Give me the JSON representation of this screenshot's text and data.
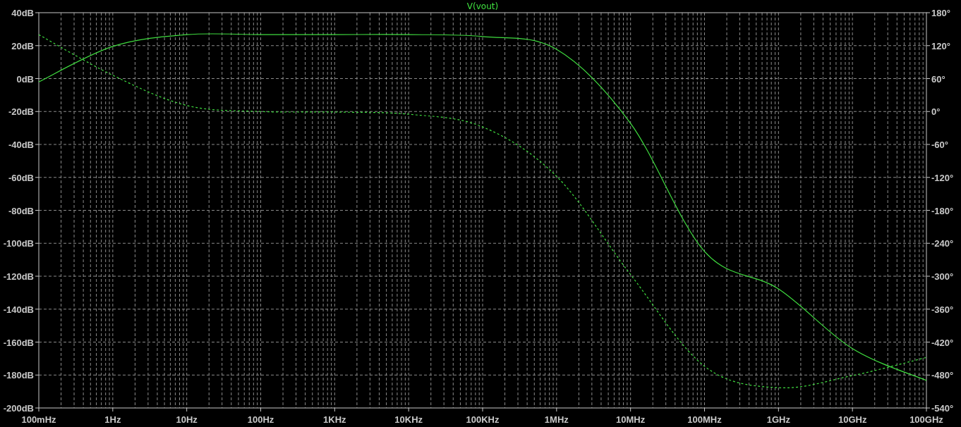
{
  "plot": {
    "chart_data": {
      "type": "line",
      "title": "V(vout)",
      "grid": true,
      "categories": [
        "100mHz",
        "1Hz",
        "10Hz",
        "100Hz",
        "1KHz",
        "10KHz",
        "100KHz",
        "1MHz",
        "10MHz",
        "100MHz",
        "1GHz",
        "10GHz",
        "100GHz"
      ],
      "ylim": [
        -200,
        40
      ],
      "yticks": [
        {
          "value": 40,
          "label": "40dB"
        },
        {
          "value": 20,
          "label": "20dB"
        },
        {
          "value": 0,
          "label": "0dB"
        },
        {
          "value": -20,
          "label": "-20dB"
        },
        {
          "value": -40,
          "label": "-40dB"
        },
        {
          "value": -60,
          "label": "-60dB"
        },
        {
          "value": -80,
          "label": "-80dB"
        },
        {
          "value": -100,
          "label": "-100dB"
        },
        {
          "value": -120,
          "label": "-120dB"
        },
        {
          "value": -140,
          "label": "-140dB"
        },
        {
          "value": -160,
          "label": "-160dB"
        },
        {
          "value": -180,
          "label": "-180dB"
        },
        {
          "value": -200,
          "label": "-200dB"
        }
      ],
      "y2lim": [
        -540,
        180
      ],
      "y2ticks": [
        {
          "value": 180,
          "label": "180°"
        },
        {
          "value": 120,
          "label": "120°"
        },
        {
          "value": 60,
          "label": "60°"
        },
        {
          "value": 0,
          "label": "0°"
        },
        {
          "value": -60,
          "label": "-60°"
        },
        {
          "value": -120,
          "label": "-120°"
        },
        {
          "value": -180,
          "label": "-180°"
        },
        {
          "value": -240,
          "label": "-240°"
        },
        {
          "value": -300,
          "label": "-300°"
        },
        {
          "value": -360,
          "label": "-360°"
        },
        {
          "value": -420,
          "label": "-420°"
        },
        {
          "value": -480,
          "label": "-480°"
        },
        {
          "value": -540,
          "label": "-540°"
        }
      ],
      "series": [
        {
          "axis": "y",
          "line_style": "solid",
          "color": "#3fdc3f",
          "values": [
            -2,
            19.5,
            26.7,
            26.7,
            26.7,
            26.7,
            25.5,
            17.8,
            -27.2,
            -105,
            -127.7,
            -164,
            -183.3
          ]
        },
        {
          "axis": "y2",
          "line_style": "dashed",
          "color": "#3fdc3f",
          "values": [
            140,
            66,
            11,
            0,
            -1,
            -5,
            -28,
            -118,
            -297,
            -464,
            -503,
            -481,
            -448
          ]
        }
      ]
    }
  }
}
